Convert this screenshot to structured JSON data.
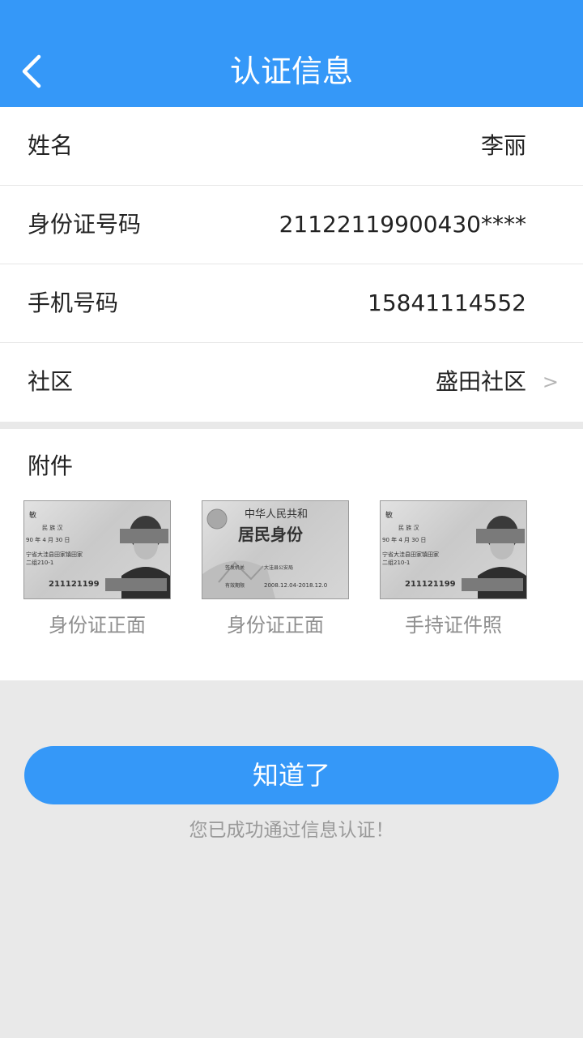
{
  "header": {
    "title": "认证信息",
    "back_icon": "chevron-left-icon"
  },
  "form": {
    "name": {
      "label": "姓名",
      "value": "李丽"
    },
    "id_number": {
      "label": "身份证号码",
      "value": "21122119900430****"
    },
    "phone": {
      "label": "手机号码",
      "value": "15841114552"
    },
    "community": {
      "label": "社区",
      "value": "盛田社区",
      "arrow": ">"
    }
  },
  "attachments": {
    "title": "附件",
    "items": [
      {
        "caption": "身份证正面",
        "card_lines": [
          "敏",
          "民 族 汉",
          "90 年 4 月 30 日",
          "宁省大洼县田家镇田家",
          "二组210-1"
        ],
        "card_number": "211121199"
      },
      {
        "caption": "身份证正面",
        "card_title": "中华人民共和",
        "card_heading": "居民身份",
        "card_lines": [
          "签发机关",
          "大洼县公安局",
          "有效期限",
          "2008.12.04-2018.12.0"
        ]
      },
      {
        "caption": "手持证件照",
        "card_lines": [
          "敏",
          "民 族 汉",
          "90 年 4 月 30 日",
          "宁省大洼县田家镇田家",
          "二组210-1"
        ],
        "card_number": "211121199"
      }
    ]
  },
  "actions": {
    "confirm_label": "知道了",
    "success_message": "您已成功通过信息认证！"
  },
  "colors": {
    "primary": "#3598f8",
    "background": "#e9e9e9"
  }
}
